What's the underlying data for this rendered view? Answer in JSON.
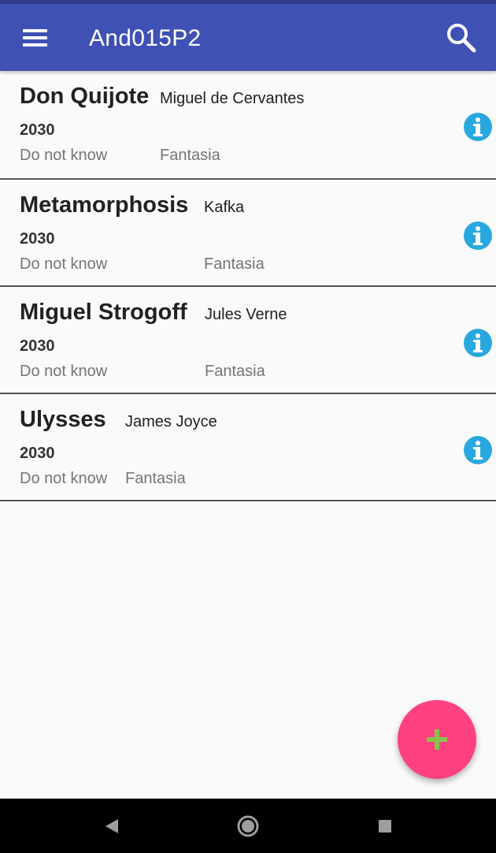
{
  "app_bar": {
    "title": "And015P2",
    "color": "#3f51b5",
    "menu_icon": "hamburger-menu-icon",
    "search_icon": "search-icon"
  },
  "books": [
    {
      "title": "Don Quijote",
      "author": "Miguel de Cervantes",
      "year": "2030",
      "status": "Do not know",
      "genre": "Fantasia"
    },
    {
      "title": "Metamorphosis",
      "author": "Kafka",
      "year": "2030",
      "status": "Do not know",
      "genre": "Fantasia"
    },
    {
      "title": "Miguel Strogoff",
      "author": "Jules Verne",
      "year": "2030",
      "status": "Do not know",
      "genre": "Fantasia"
    },
    {
      "title": "Ulysses",
      "author": "James Joyce",
      "year": "2030",
      "status": "Do not know",
      "genre": "Fantasia"
    }
  ],
  "info_icon": "info-icon",
  "info_color": "#29a8e0",
  "fab": {
    "icon": "plus-icon",
    "color": "#ff4081",
    "icon_color": "#8bc34a"
  },
  "system_nav": {
    "back_icon": "back-triangle-icon",
    "home_icon": "home-circle-icon",
    "recents_icon": "recents-square-icon"
  }
}
